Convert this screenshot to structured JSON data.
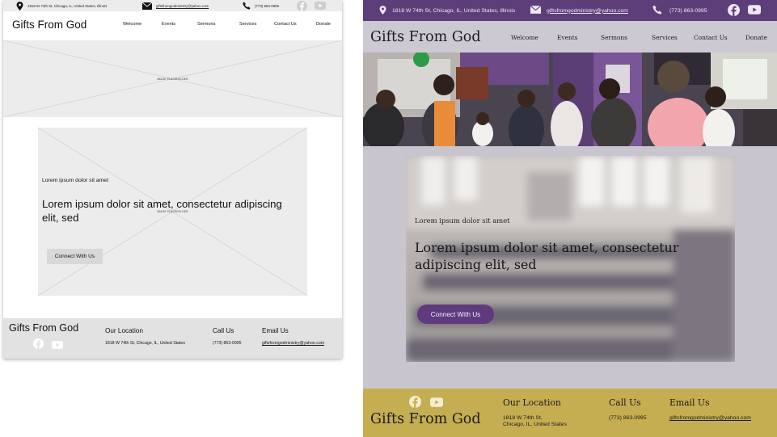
{
  "wireframe": {
    "topbar": {
      "address": "1818 W 74th St, Chicago, IL, United States, Illinois",
      "email": "giftsfromgodministry@yahoo.com",
      "phone": "(773) 863-0995"
    },
    "brand": "Gifts From God",
    "nav": [
      "Welcome",
      "Events",
      "Sermons",
      "Services",
      "Contact Us",
      "Donate"
    ],
    "hero_placeholder": "IMAGE PLACEHOLDER",
    "card_placeholder": "IMAGE PLACEHOLDER",
    "eyebrow": "Lorem ipsum dolor sit amet",
    "heading": "Lorem ipsum dolor sit amet, consectetur adipiscing elit, sed",
    "cta": "Connect With Us",
    "footer": {
      "brand": "Gifts From God",
      "location_title": "Our Location",
      "location": "1818 W 74th St, Chicago, IL, United States",
      "call_title": "Call Us",
      "phone": "(773) 863-0995",
      "email_title": "Email Us",
      "email": "giftsfromgodministry@yahoo.com"
    }
  },
  "design": {
    "topbar": {
      "address": "1818 W 74th St, Chicago, IL, United States, Illinois",
      "email": "giftsfromgodministry@yahoo.com",
      "phone": "(773) 863-0995"
    },
    "brand": "Gifts From God",
    "nav": [
      "Welcome",
      "Events",
      "Sermons",
      "Services",
      "Contact Us",
      "Donate"
    ],
    "eyebrow": "Lorem ipsum dolor sit amet",
    "heading": "Lorem ipsum dolor sit amet, consectetur adipiscing elit, sed",
    "cta": "Connect With Us",
    "footer": {
      "brand": "Gifts From God",
      "location_title": "Our Location",
      "location_line1": "1818 W 74th St,",
      "location_line2": "Chicago, IL, United States",
      "call_title": "Call Us",
      "phone": "(773) 863-0995",
      "email_title": "Email Us",
      "email": "giftsfromgodministry@yahoo.com"
    }
  },
  "colors": {
    "design_topbar": "#5e3e78",
    "design_cta": "#5f3a7e",
    "design_footer": "#c5ad52",
    "design_background": "#c9c5cf",
    "wireframe_placeholder": "#ececec"
  },
  "icons": [
    "map-pin-icon",
    "envelope-icon",
    "phone-icon",
    "facebook-icon",
    "youtube-icon"
  ]
}
